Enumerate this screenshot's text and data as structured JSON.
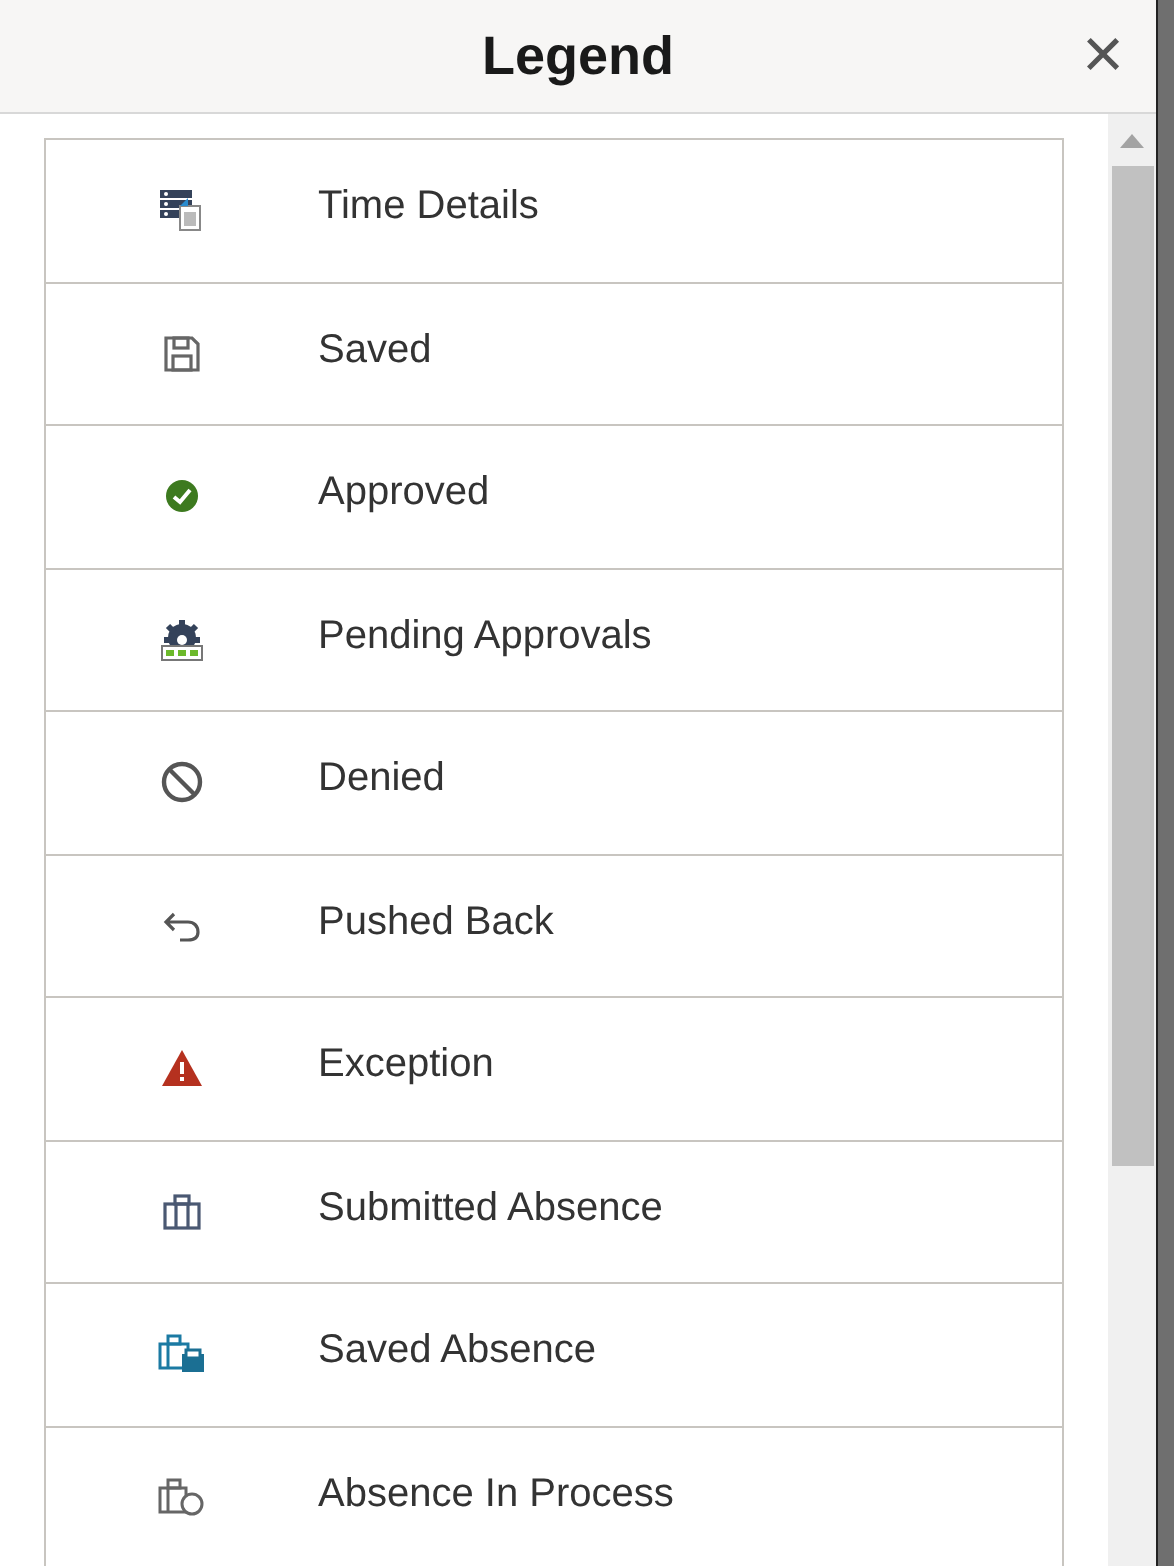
{
  "dialog": {
    "title": "Legend",
    "close": "×"
  },
  "items": [
    {
      "kind": "time-details",
      "label": "Time Details"
    },
    {
      "kind": "saved",
      "label": "Saved"
    },
    {
      "kind": "approved",
      "label": "Approved"
    },
    {
      "kind": "pending",
      "label": "Pending Approvals"
    },
    {
      "kind": "denied",
      "label": "Denied"
    },
    {
      "kind": "pushed-back",
      "label": "Pushed Back"
    },
    {
      "kind": "exception",
      "label": "Exception"
    },
    {
      "kind": "submitted-absence",
      "label": "Submitted Absence"
    },
    {
      "kind": "saved-absence",
      "label": "Saved Absence"
    },
    {
      "kind": "absence-in-process",
      "label": "Absence In Process"
    }
  ]
}
